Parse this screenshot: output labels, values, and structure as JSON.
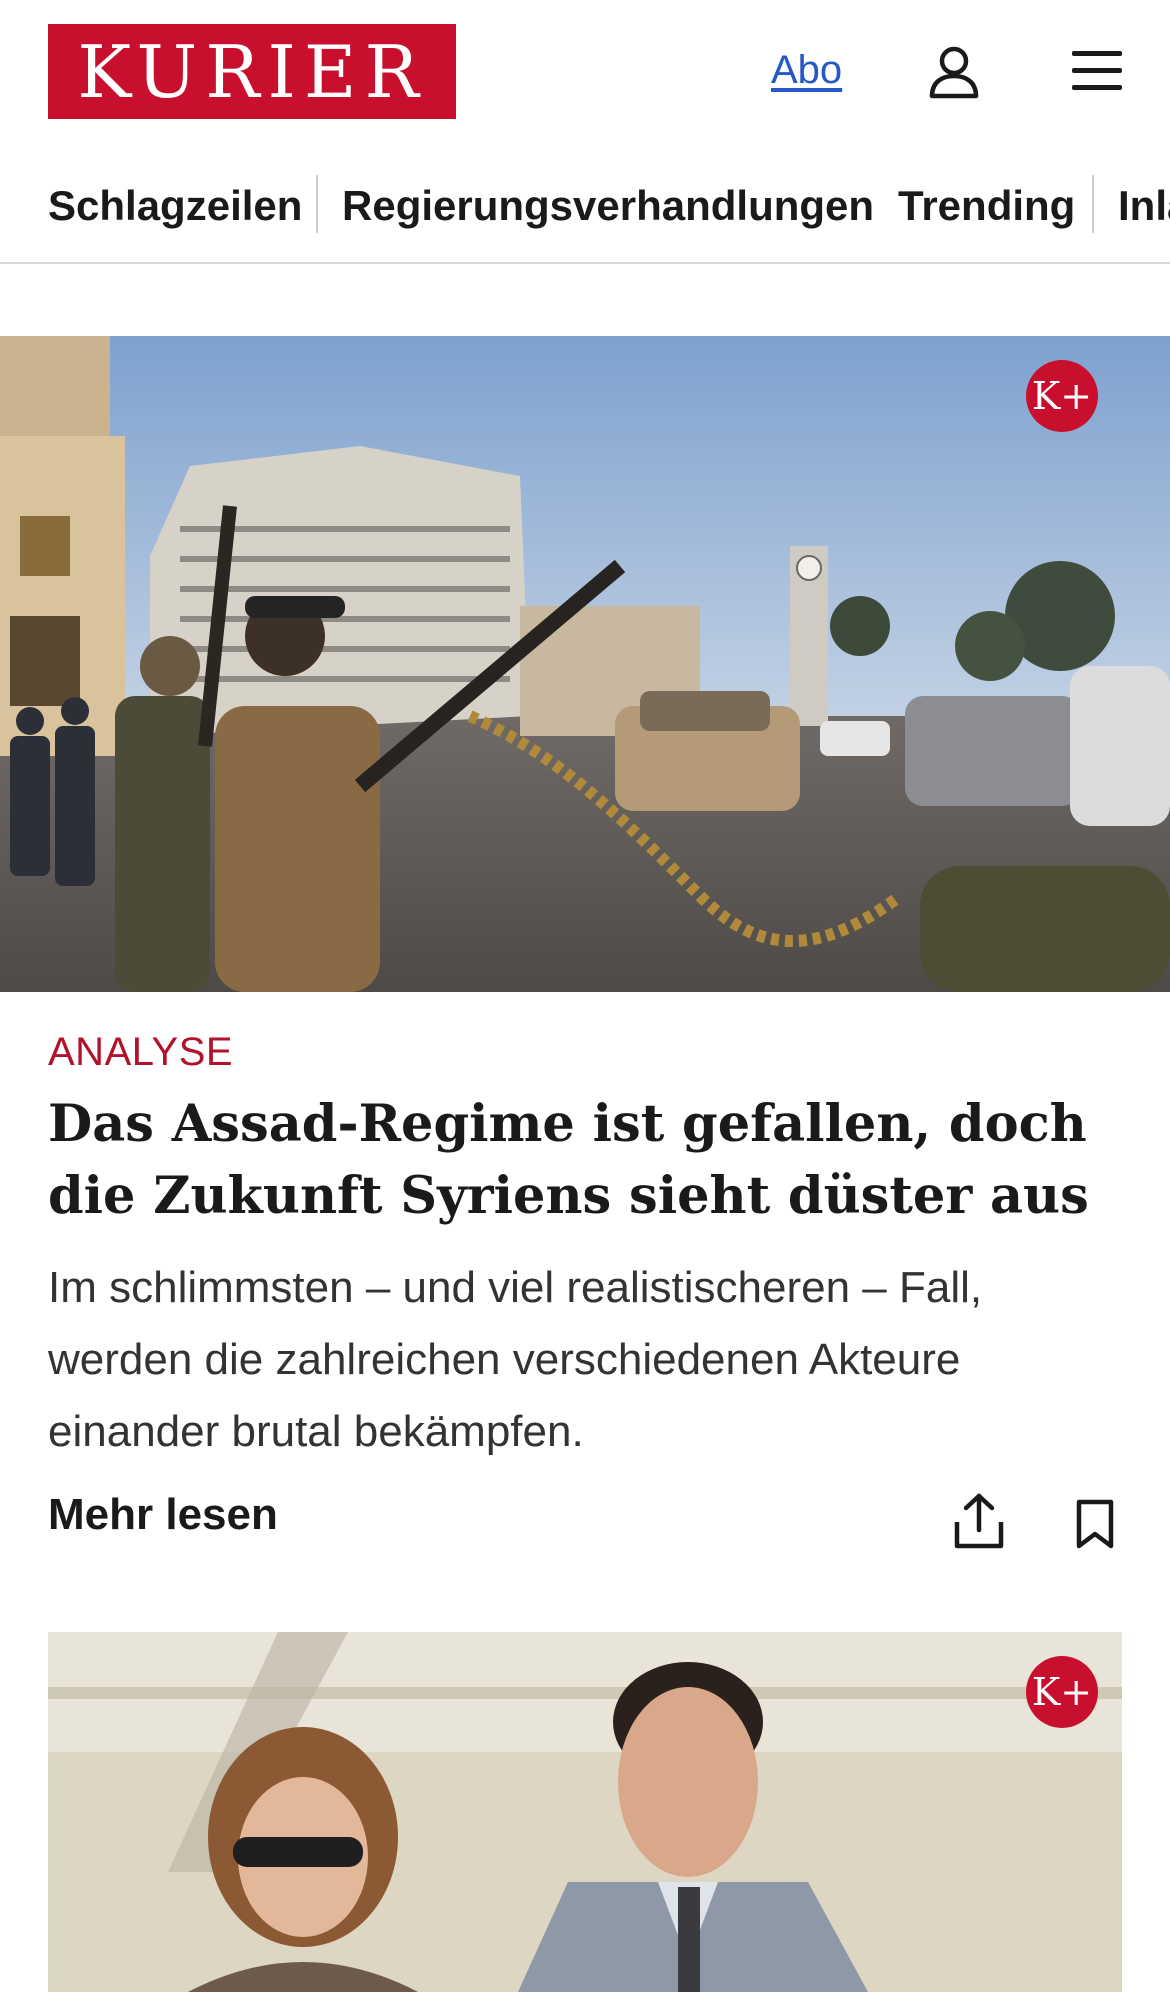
{
  "header": {
    "logo_text": "KURIER",
    "abo_label": "Abo",
    "brand_color": "#c8102e",
    "link_color": "#2457c8",
    "icons": {
      "account": "user-icon",
      "menu": "hamburger-menu-icon"
    }
  },
  "nav": {
    "items": [
      {
        "label": "Schlagzeilen"
      },
      {
        "label": "Regierungsverhandlungen"
      },
      {
        "label": "Trending"
      },
      {
        "label": "Inla"
      }
    ]
  },
  "articles": [
    {
      "image_alt": "Kämpfer mit Maschinengewehr auf einem Platz mit Uhrturm",
      "badge": "K+",
      "kicker": "ANALYSE",
      "headline": "Das Assad-Regime ist gefallen, doch die Zukunft Syriens sieht düster aus",
      "teaser": "Im schlimmsten – und viel realistischeren – Fall, werden die zahlreichen verschiedenen Akteure einander brutal bekämpfen.",
      "more_label": "Mehr lesen",
      "icons": {
        "share": "share-icon",
        "bookmark": "bookmark-icon"
      }
    },
    {
      "image_alt": "Frau mit Sonnenbrille und Mann im grauen Anzug",
      "badge": "K+"
    }
  ]
}
